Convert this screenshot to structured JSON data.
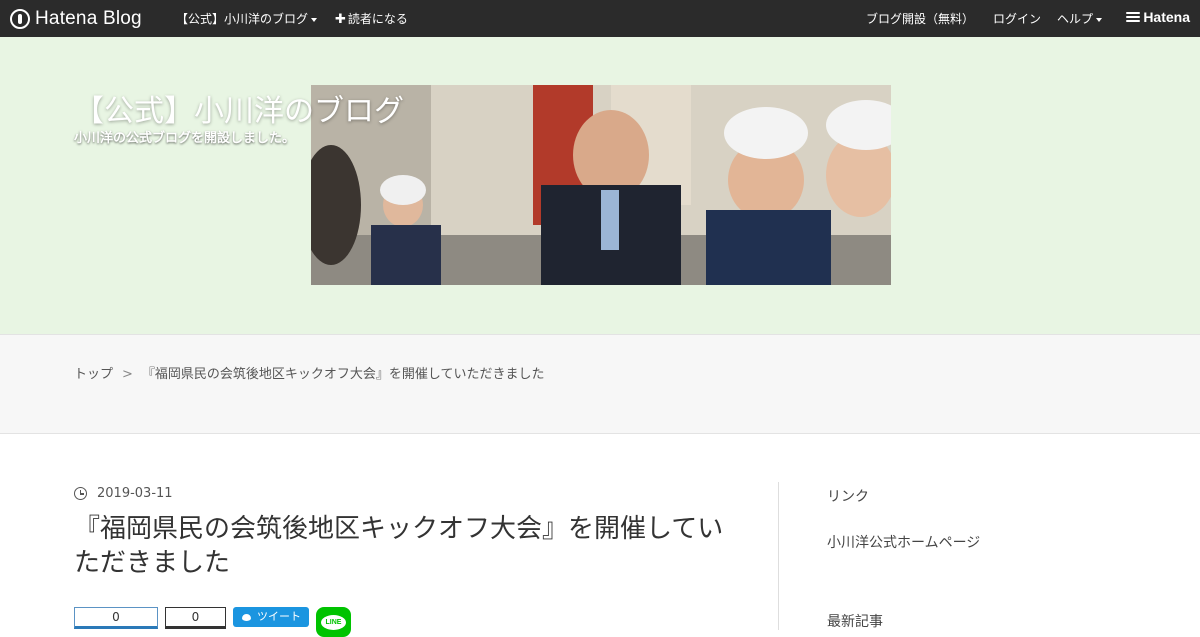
{
  "topbar": {
    "brand": "Hatena Blog",
    "blog_menu": "【公式】小川洋のブログ",
    "subscribe": "読者になる",
    "open_blog": "ブログ開設（無料）",
    "login": "ログイン",
    "help": "ヘルプ",
    "hatena": "Hatena"
  },
  "header": {
    "title": "【公式】小川洋のブログ",
    "description": "小川洋の公式ブログを開設しました。"
  },
  "breadcrumb": {
    "home": "トップ",
    "separator": ">",
    "current": "『福岡県民の会筑後地区キックオフ大会』を開催していただきました"
  },
  "entry": {
    "date": "2019-03-11",
    "title": "『福岡県民の会筑後地区キックオフ大会』を開催していただきました"
  },
  "share": {
    "count_1": "0",
    "count_2": "0",
    "tweet": "ツイート",
    "line": "LINE"
  },
  "sidebar": {
    "links_heading": "リンク",
    "link_1": "小川洋公式ホームページ",
    "recent_heading": "最新記事"
  },
  "colors": {
    "topbar": "#2b2b2b",
    "header_bg": "#e8f5e3",
    "twitter": "#1b95e0",
    "line": "#00c300"
  }
}
